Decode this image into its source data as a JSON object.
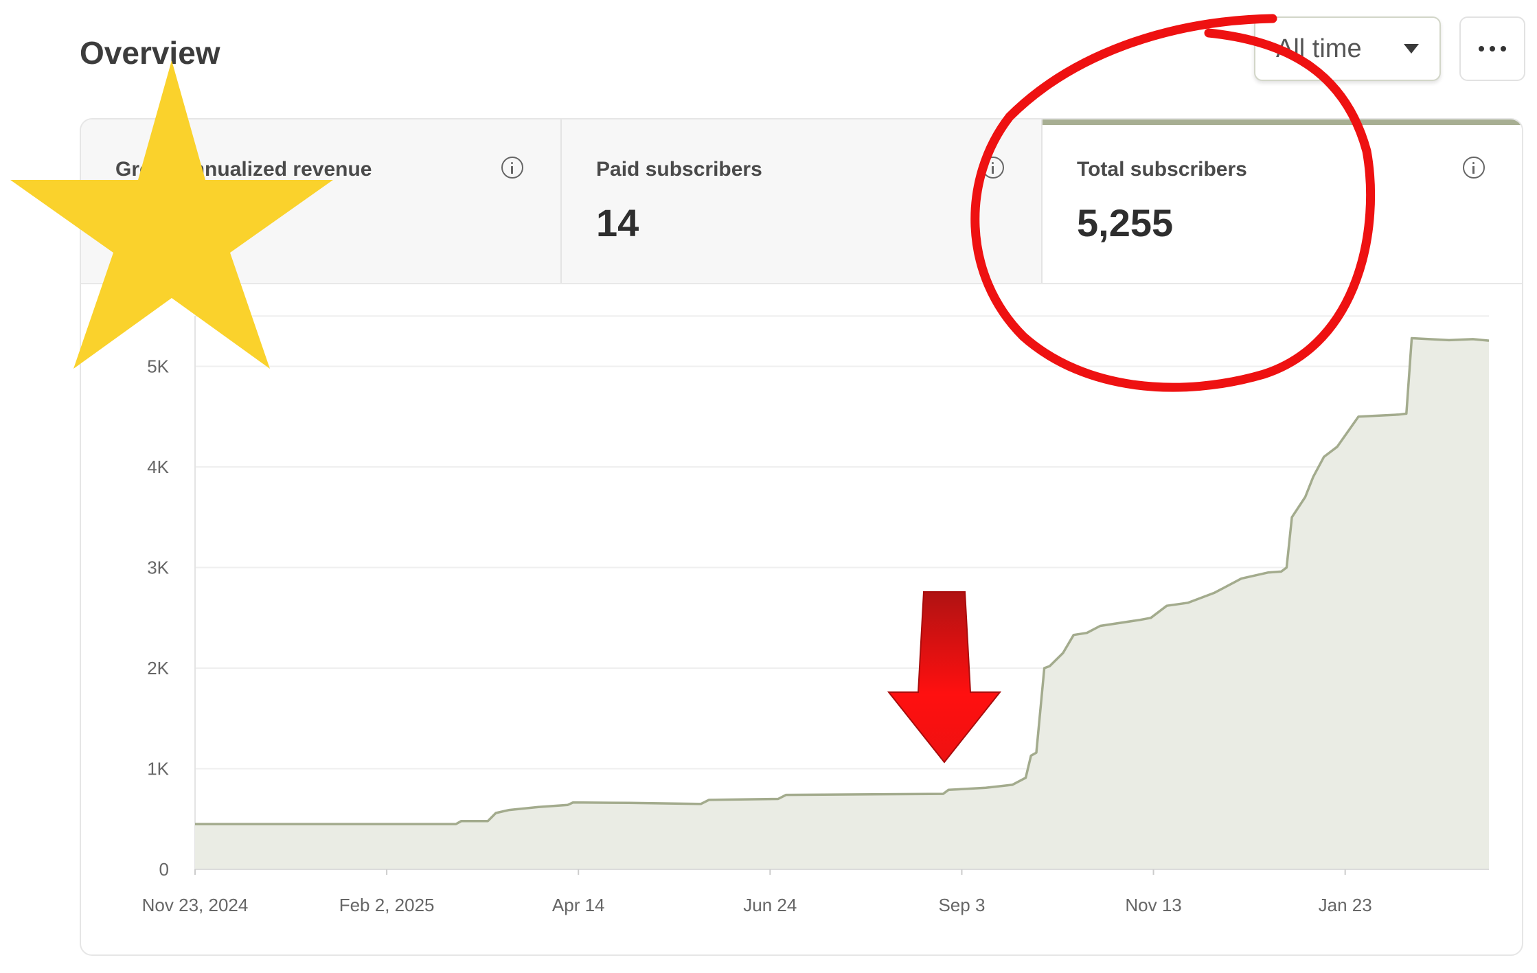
{
  "header": {
    "title": "Overview",
    "range_selector": {
      "selected": "All time"
    },
    "more_label": "More options"
  },
  "stats": [
    {
      "label": "Gross annualized revenue",
      "value": ""
    },
    {
      "label": "Paid subscribers",
      "value": "14"
    },
    {
      "label": "Total subscribers",
      "value": "5,255",
      "active": true
    }
  ],
  "colors": {
    "line": "#a3ab8d",
    "fill": "#eaece4",
    "active_tab": "#a7ae92",
    "annotation_red": "#ee1111",
    "star": "#fad22c"
  },
  "chart_data": {
    "type": "area",
    "title": "",
    "xlabel": "",
    "ylabel": "",
    "ylim": [
      0,
      5500
    ],
    "y_ticks": [
      {
        "value": 0,
        "label": "0"
      },
      {
        "value": 1000,
        "label": "1K"
      },
      {
        "value": 2000,
        "label": "2K"
      },
      {
        "value": 3000,
        "label": "3K"
      },
      {
        "value": 4000,
        "label": "4K"
      },
      {
        "value": 5000,
        "label": "5K"
      }
    ],
    "x_ticks": [
      "Nov 23, 2024",
      "Feb 2, 2025",
      "Apr 14",
      "Jun 24",
      "Sep 3",
      "Nov 13",
      "Jan 23"
    ],
    "x_start": "2024-11-23",
    "x_end": "2026-03-24",
    "grid": true,
    "series": [
      {
        "points": [
          [
            "2024-11-23",
            450
          ],
          [
            "2025-03-01",
            450
          ],
          [
            "2025-03-03",
            480
          ],
          [
            "2025-03-13",
            480
          ],
          [
            "2025-03-16",
            560
          ],
          [
            "2025-03-21",
            590
          ],
          [
            "2025-04-01",
            620
          ],
          [
            "2025-04-12",
            640
          ],
          [
            "2025-04-14",
            665
          ],
          [
            "2025-05-05",
            660
          ],
          [
            "2025-06-01",
            650
          ],
          [
            "2025-06-04",
            690
          ],
          [
            "2025-06-30",
            700
          ],
          [
            "2025-07-03",
            740
          ],
          [
            "2025-08-31",
            750
          ],
          [
            "2025-09-02",
            790
          ],
          [
            "2025-09-16",
            810
          ],
          [
            "2025-09-26",
            840
          ],
          [
            "2025-10-01",
            910
          ],
          [
            "2025-10-03",
            1130
          ],
          [
            "2025-10-05",
            1160
          ],
          [
            "2025-10-08",
            2000
          ],
          [
            "2025-10-10",
            2020
          ],
          [
            "2025-10-15",
            2150
          ],
          [
            "2025-10-19",
            2330
          ],
          [
            "2025-10-24",
            2350
          ],
          [
            "2025-10-29",
            2420
          ],
          [
            "2025-11-13",
            2480
          ],
          [
            "2025-11-17",
            2500
          ],
          [
            "2025-11-23",
            2620
          ],
          [
            "2025-12-01",
            2650
          ],
          [
            "2025-12-11",
            2750
          ],
          [
            "2025-12-21",
            2890
          ],
          [
            "2025-12-31",
            2950
          ],
          [
            "2026-01-05",
            2960
          ],
          [
            "2026-01-07",
            3000
          ],
          [
            "2026-01-09",
            3500
          ],
          [
            "2026-01-14",
            3700
          ],
          [
            "2026-01-17",
            3900
          ],
          [
            "2026-01-21",
            4100
          ],
          [
            "2026-01-26",
            4200
          ],
          [
            "2026-02-03",
            4500
          ],
          [
            "2026-02-18",
            4520
          ],
          [
            "2026-02-21",
            4530
          ],
          [
            "2026-02-23",
            5280
          ],
          [
            "2026-03-09",
            5260
          ],
          [
            "2026-03-18",
            5270
          ],
          [
            "2026-03-24",
            5255
          ]
        ]
      }
    ]
  }
}
